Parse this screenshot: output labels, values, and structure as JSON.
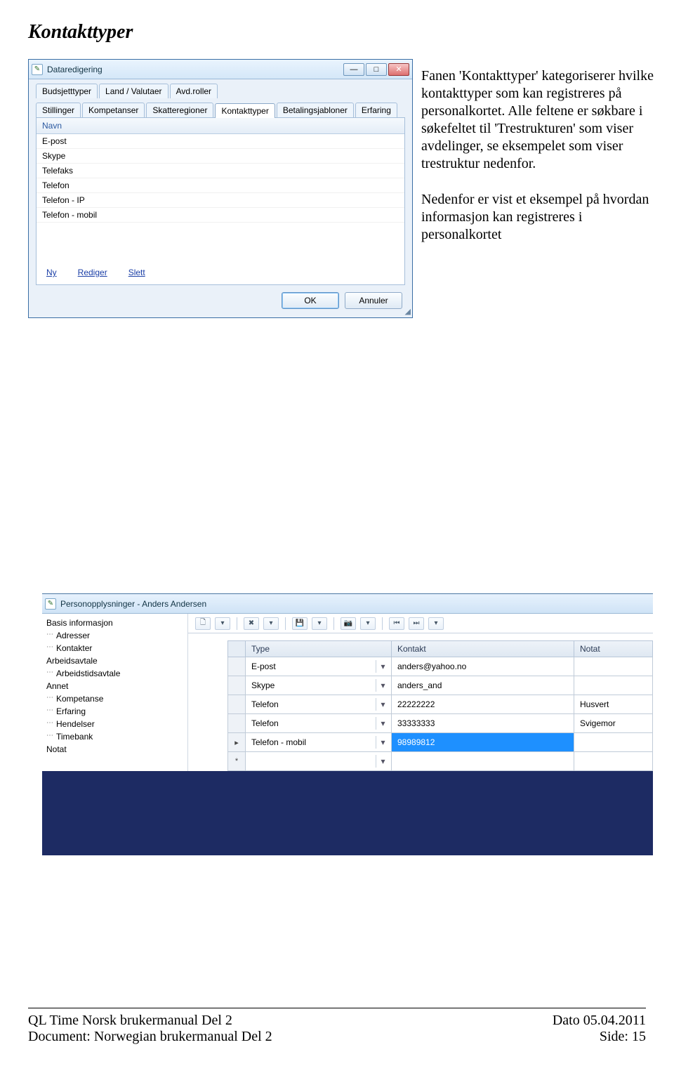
{
  "page": {
    "title": "Kontakttyper"
  },
  "para1": "Fanen 'Kontakttyper' kategoriserer hvilke kontakttyper som kan registreres på personalkortet. Alle feltene er søkbare i søkefeltet til 'Trestrukturen' som viser avdelinger, se eksempelet som viser trestruktur nedenfor.",
  "para2": "Nedenfor er vist et eksempel på hvordan informasjon kan registreres i personalkortet",
  "win1": {
    "title": "Dataredigering",
    "tabs_row1": [
      "Budsjetttyper",
      "Land / Valutaer",
      "Avd.roller"
    ],
    "tabs_row2": [
      "Stillinger",
      "Kompetanser",
      "Skatteregioner",
      "Kontakttyper",
      "Betalingsjabloner",
      "Erfaring"
    ],
    "active_tab": "Kontakttyper",
    "list_header": "Navn",
    "list_items": [
      "E-post",
      "Skype",
      "Telefaks",
      "Telefon",
      "Telefon - IP",
      "Telefon - mobil"
    ],
    "links": {
      "ny": "Ny",
      "rediger": "Rediger",
      "slett": "Slett"
    },
    "buttons": {
      "ok": "OK",
      "annuler": "Annuler"
    }
  },
  "win2": {
    "title": "Personopplysninger - Anders Andersen",
    "nav": [
      {
        "label": "Basis informasjon",
        "level": 0
      },
      {
        "label": "Adresser",
        "level": 1
      },
      {
        "label": "Kontakter",
        "level": 1
      },
      {
        "label": "Arbeidsavtale",
        "level": 0
      },
      {
        "label": "Arbeidstidsavtale",
        "level": 1
      },
      {
        "label": "Annet",
        "level": 0
      },
      {
        "label": "Kompetanse",
        "level": 1
      },
      {
        "label": "Erfaring",
        "level": 1
      },
      {
        "label": "Hendelser",
        "level": 1
      },
      {
        "label": "Timebank",
        "level": 1
      },
      {
        "label": "Notat",
        "level": 0
      }
    ],
    "grid": {
      "headers": {
        "type": "Type",
        "kontakt": "Kontakt",
        "notat": "Notat"
      },
      "rows": [
        {
          "type": "E-post",
          "kontakt": "anders@yahoo.no",
          "notat": ""
        },
        {
          "type": "Skype",
          "kontakt": "anders_and",
          "notat": ""
        },
        {
          "type": "Telefon",
          "kontakt": "22222222",
          "notat": "Husvert"
        },
        {
          "type": "Telefon",
          "kontakt": "33333333",
          "notat": "Svigemor"
        },
        {
          "type": "Telefon - mobil",
          "kontakt": "98989812",
          "notat": "",
          "selected": true
        }
      ]
    }
  },
  "footer": {
    "left1": "QL Time Norsk brukermanual Del 2",
    "right1": "Dato 05.04.2011",
    "left2": "Document: Norwegian brukermanual Del 2",
    "right2": "Side: 15"
  }
}
